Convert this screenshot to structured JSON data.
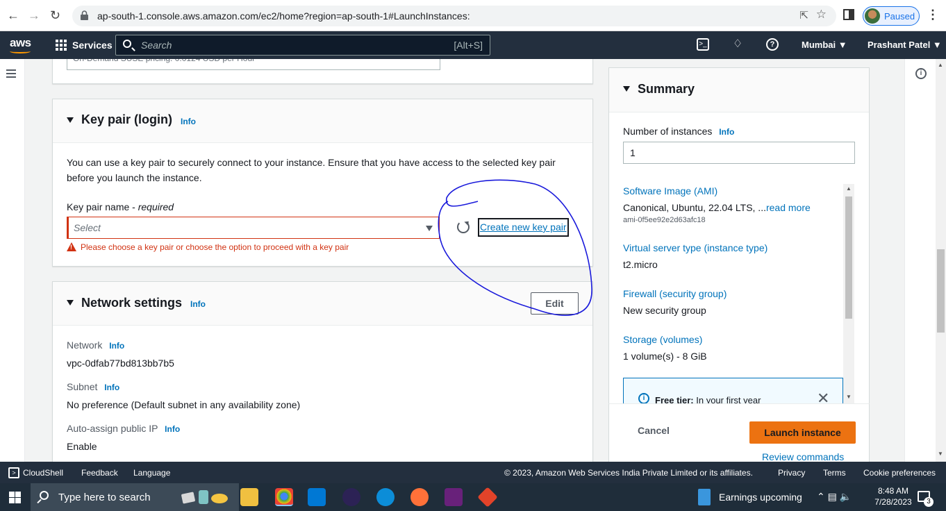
{
  "browser": {
    "url": "ap-south-1.console.aws.amazon.com/ec2/home?region=ap-south-1#LaunchInstances:",
    "profile_status": "Paused"
  },
  "aws_nav": {
    "logo": "aws",
    "services_label": "Services",
    "search_placeholder": "Search",
    "search_hotkey": "[Alt+S]",
    "region": "Mumbai ▼",
    "user": "Prashant Patel ▼"
  },
  "prev_field_text": "On-Demand SUSE pricing: 0.0124 USD per Hour",
  "key_pair": {
    "title": "Key pair (login)",
    "info": "Info",
    "description": "You can use a key pair to securely connect to your instance. Ensure that you have access to the selected key pair before you launch the instance.",
    "field_label": "Key pair name - ",
    "field_required": "required",
    "select_placeholder": "Select",
    "create_link": "Create new key pair",
    "error": "Please choose a key pair or choose the option to proceed with a key pair"
  },
  "network": {
    "title": "Network settings",
    "info": "Info",
    "edit_label": "Edit",
    "network_label": "Network",
    "network_value": "vpc-0dfab77bd813bb7b5",
    "subnet_label": "Subnet",
    "subnet_value": "No preference (Default subnet in any availability zone)",
    "public_ip_label": "Auto-assign public IP",
    "public_ip_value": "Enable"
  },
  "summary": {
    "title": "Summary",
    "instances_label": "Number of instances",
    "info": "Info",
    "instances_value": "1",
    "ami_link": "Software Image (AMI)",
    "ami_text": "Canonical, Ubuntu, 22.04 LTS, ...",
    "ami_readmore": "read more",
    "ami_id": "ami-0f5ee92e2d63afc18",
    "type_link": "Virtual server type (instance type)",
    "type_value": "t2.micro",
    "firewall_link": "Firewall (security group)",
    "firewall_value": "New security group",
    "storage_link": "Storage (volumes)",
    "storage_value": "1 volume(s) - 8 GiB",
    "free_tier_bold": "Free tier:",
    "free_tier_text": " In your first year",
    "cancel_label": "Cancel",
    "launch_label": "Launch instance",
    "review_label": "Review commands"
  },
  "footer": {
    "cloudshell": "CloudShell",
    "feedback": "Feedback",
    "language": "Language",
    "copyright": "© 2023, Amazon Web Services India Private Limited or its affiliates.",
    "privacy": "Privacy",
    "terms": "Terms",
    "cookies": "Cookie preferences"
  },
  "taskbar": {
    "search_placeholder": "Type here to search",
    "earnings": "Earnings upcoming",
    "time": "8:48 AM",
    "date": "7/28/2023",
    "notifications": "3"
  },
  "colors": {
    "aws_nav": "#232f3e",
    "link": "#0073bb",
    "error": "#d13212",
    "launch": "#ec7211",
    "annotation": "#1a1adb"
  }
}
